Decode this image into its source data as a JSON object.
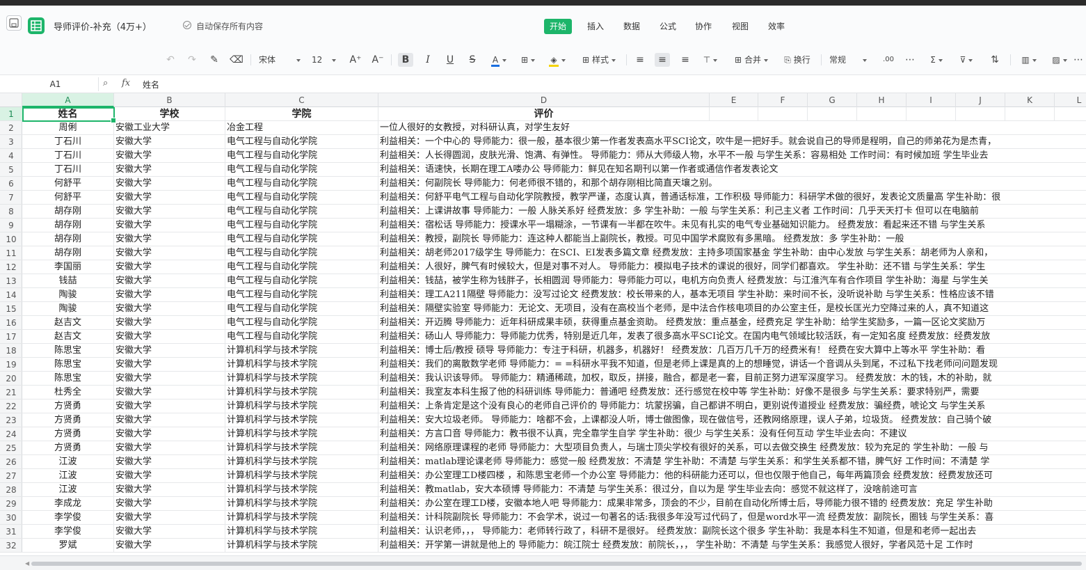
{
  "app": {
    "doc_title": "导师评价-补充（4万+）",
    "autosave": "自动保存所有内容"
  },
  "menu": [
    "开始",
    "插入",
    "数据",
    "公式",
    "协作",
    "视图",
    "效率"
  ],
  "toolbar": {
    "font_name": "宋体",
    "font_size": "12",
    "bold": "B",
    "italic": "I",
    "underline": "U",
    "strike": "S",
    "style_label": "样式",
    "merge_label": "合并",
    "wrap_label": "换行",
    "format_label": "常规",
    "sum_symbol": "Σ",
    "font_color": "#1a6fe0",
    "fill_color": "#f5d400"
  },
  "formula_bar": {
    "cell_ref": "A1",
    "fx": "fx",
    "content": "姓名"
  },
  "columns": [
    "A",
    "B",
    "C",
    "D",
    "E",
    "F",
    "G",
    "H",
    "I",
    "J",
    "K",
    "L"
  ],
  "header_row": [
    "姓名",
    "学校",
    "学院",
    "评价"
  ],
  "rows": [
    [
      "周俐",
      "安徽工业大学",
      "冶金工程",
      "一位人很好的女教授，对科研认真，对学生友好"
    ],
    [
      "丁石川",
      "安徽大学",
      "电气工程与自动化学院",
      "利益相关：一个中心的 导师能力：很一般，基本很少第一作者发表高水平SCI论文，吹牛是一把好手。就会说自己的导师是程明，自己的师弟花为是杰青，"
    ],
    [
      "丁石川",
      "安徽大学",
      "电气工程与自动化学院",
      "利益相关：人长得圆润，皮肤光滑、饱满、有弹性。 导师能力：师从大师级人物，水平不一般 与学生关系：容易相处 工作时间：有时候加班 学生毕业去"
    ],
    [
      "丁石川",
      "安徽大学",
      "电气工程与自动化学院",
      "利益相关：语速快，长期在理工A喽办公 导师能力：鲜见在知名期刊以第一作者或通信作者发表论文"
    ],
    [
      "何舒平",
      "安徽大学",
      "电气工程与自动化学院",
      "利益相关：何副院长 导师能力：何老师很不错的，和那个胡存刚相比简直天壤之别。"
    ],
    [
      "何舒平",
      "安徽大学",
      "电气工程与自动化学院",
      "利益相关：何舒平电气工程与自动化学院教授，教学严谨，态度认真，普通话标准，工作积极 导师能力：科研学术做的很好，发表论文质量高 学生补助：很"
    ],
    [
      "胡存刚",
      "安徽大学",
      "电气工程与自动化学院",
      "利益相关：上课讲故事 导师能力：一般 人脉关系好 经费发放：多 学生补助：一般 与学生关系：利己主义者 工作时间：几乎天天打卡 但可以在电脑前"
    ],
    [
      "胡存刚",
      "安徽大学",
      "电气工程与自动化学院",
      "利益相关：宿松话 导师能力：授课水平一塌糊涂，一节课有一半都在吹牛。未见有扎实的电气专业基础知识能力。 经费发放：看起来还不错 与学生关系"
    ],
    [
      "胡存刚",
      "安徽大学",
      "电气工程与自动化学院",
      "利益相关：教授，副院长 导师能力：连这种人都能当上副院长，教授。可见中国学术腐败有多黑暗。 经费发放：多 学生补助：一般"
    ],
    [
      "胡存刚",
      "安徽大学",
      "电气工程与自动化学院",
      "利益相关：胡老师2017级学生 导师能力：在SCI、EI发表多篇文章 经费发放：主持多项国家基金 学生补助：由中心发放 与学生关系：胡老师为人亲和，"
    ],
    [
      "李国丽",
      "安徽大学",
      "电气工程与自动化学院",
      "利益相关：人很好，脾气有时候较大，但是对事不对人。 导师能力：模拟电子技术的课说的很好，同学们都喜欢。 学生补助：还不错 与学生关系：学生"
    ],
    [
      "钱喆",
      "安徽大学",
      "电气工程与自动化学院",
      "利益相关：钱喆，被学生称为钱胖子，长相圆润 导师能力：导师能力可以，电机方向负责人 经费发放：与江淮汽车有合作项目 学生补助：海星 与学生关"
    ],
    [
      "陶骏",
      "安徽大学",
      "电气工程与自动化学院",
      "利益相关：理工A211隔壁 导师能力：没写过论文 经费发放：校长带来的人，基本无项目 学生补助：来时间不长，没听说补助 与学生关系：性格应该不错"
    ],
    [
      "陶骏",
      "安徽大学",
      "电气工程与自动化学院",
      "利益相关：隔壁实验室 导师能力：无论文、无项目，没有在高校当个老师，是中法合作核电项目的办公室主任，是校长匡光力空降过来的人，真不知道这"
    ],
    [
      "赵吉文",
      "安徽大学",
      "电气工程与自动化学院",
      "利益相关：开迈腾 导师能力：近年科研成果丰硕，获得重点基金资助。 经费发放：重点基金，经费充足 学生补助：给学生奖励多，一篇一区论文奖励万"
    ],
    [
      "赵吉文",
      "安徽大学",
      "电气工程与自动化学院",
      "利益相关：砀山人 导师能力：导师能力优秀，特别是近几年，发表了很多高水平SCI论文。在国内电气领域比较活跃，有一定知名度 经费发放：经费发放"
    ],
    [
      "陈思宝",
      "安徽大学",
      "计算机科学与技术学院",
      "利益相关：博士后/教授 硕导 导师能力：专注于科研，机器多，机器好！ 经费发放：几百万几千万的经费米有！ 经费在安大算中上等水平 学生补助：看"
    ],
    [
      "陈思宝",
      "安徽大学",
      "计算机科学与技术学院",
      "利益相关：我们的离散数学老师 导师能力：= =科研水平我不知道，但是老师上课是真的上的想睡觉，讲话一个音调从头到尾，不过私下找老师问问题发现"
    ],
    [
      "陈思宝",
      "安徽大学",
      "计算机科学与技术学院",
      "利益相关：我认识该导师。 导师能力：精通稀疏，加权，取反，拼接，融合，都是老一套，目前正努力进军深度学习。 经费发放：木的钱，木的补助，就"
    ],
    [
      "杜秀全",
      "安徽大学",
      "计算机科学与技术学院",
      "利益相关：我室友本科生报了他的科研训练 导师能力：普通吧 经费发放：还行感觉在校中等 学生补助：好像不是很多 与学生关系：要求特别严，需要"
    ],
    [
      "方贤勇",
      "安徽大学",
      "计算机科学与技术学院",
      "利益相关：上条肯定是这个没有良心的老师自己评价的 导师能力：坑蒙拐骗，自己都讲不明白，更别说传道授业 经费发放：骗经费，唬论文 与学生关系"
    ],
    [
      "方贤勇",
      "安徽大学",
      "计算机科学与技术学院",
      "利益相关：安大垃圾老师。 导师能力：啥都不会，上课都没人听，博士做图像，现在做信号，还教网络原理，误人子弟，垃圾货。 经费发放：自己骑个破"
    ],
    [
      "方贤勇",
      "安徽大学",
      "计算机科学与技术学院",
      "利益相关：方言口音 导师能力：教书很不认真，完全靠学生自学 学生补助：很少 与学生关系：没有任何互动 学生毕业去向：不建议"
    ],
    [
      "方贤勇",
      "安徽大学",
      "计算机科学与技术学院",
      "利益相关：网络原理课程的老师 导师能力：大型项目负责人，与瑞士顶尖学校有很好的关系，可以去做交换生 经费发放：较为充足的 学生补助：一般 与"
    ],
    [
      "江波",
      "安徽大学",
      "计算机科学与技术学院",
      "利益相关：matlab理论课老师 导师能力：感觉一般 经费发放：不清楚 学生补助：不清楚 与学生关系：和学生关系都不错，脾气好 工作时间：不清楚 学"
    ],
    [
      "江波",
      "安徽大学",
      "计算机科学与技术学院",
      "利益相关：办公室理工D楼四楼 ，和陈思宝老师一个办公室 导师能力：他的科研能力还可以，但也仅限于他自己，每年两篇顶会 经费发放：经费发放还可"
    ],
    [
      "江波",
      "安徽大学",
      "计算机科学与技术学院",
      "利益相关：教matlab，安大本硕博 导师能力：不清楚 与学生关系：很过分，自以为是 学生毕业去向：感觉不就这样了，没啥前途可言"
    ],
    [
      "李成龙",
      "安徽大学",
      "计算机科学与技术学院",
      "利益相关：办公室在理工D楼，安徽本地人吧 导师能力：成果非常多，顶会的不少，目前在自动化所博士后，导师能力很不错的 经费发放：充足 学生补助"
    ],
    [
      "李学俊",
      "安徽大学",
      "计算机科学与技术学院",
      "利益相关：计科院副院长 导师能力：不会学术，说过一句著名的话:我很多年没写过代码了，但是word水平一流 经费发放：副院长，圈钱 与学生关系：喜"
    ],
    [
      "李学俊",
      "安徽大学",
      "计算机科学与技术学院",
      "利益相关：认识老师，，， 导师能力：老师转行政了，科研不是很好。 经费发放：副院长这个很多 学生补助：我是本科生不知道，但是和老师一起出去"
    ],
    [
      "罗斌",
      "安徽大学",
      "计算机科学与技术学院",
      "利益相关：开学第一讲就是他上的 导师能力：皖江院士 经费发放：前院长，，， 学生补助：不清楚 与学生关系：我感觉人很好，学者风范十足 工作时"
    ]
  ]
}
